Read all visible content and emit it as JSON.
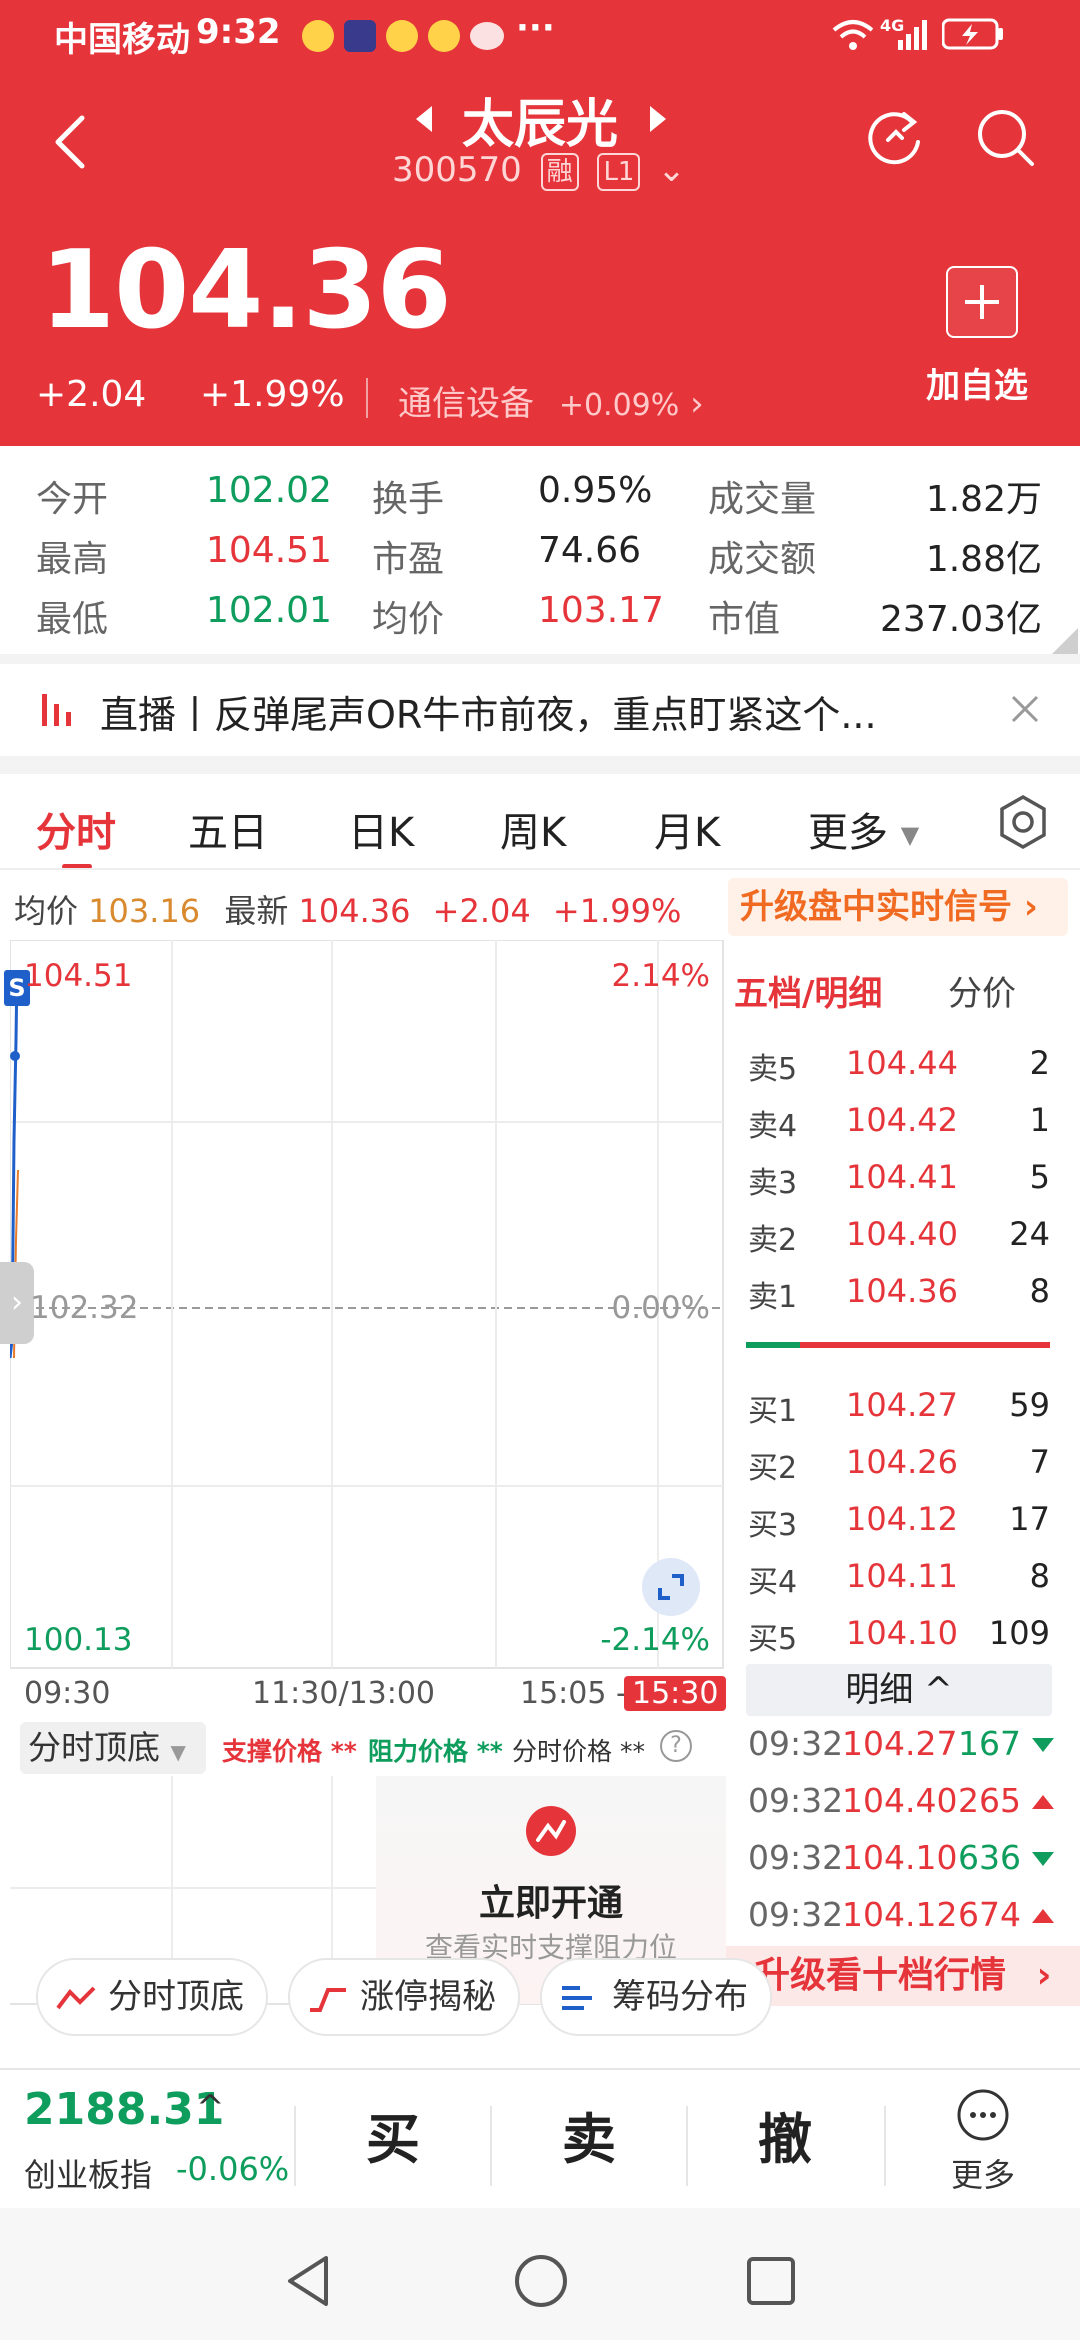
{
  "status_bar": {
    "carrier": "中国移动",
    "time": "9:32",
    "network": "4G",
    "more": "···"
  },
  "header": {
    "stock_name": "太辰光",
    "stock_code": "300570",
    "tag_margin": "融",
    "tag_level": "L1",
    "price": "104.36",
    "change": "+2.04",
    "change_pct": "+1.99%",
    "sector": "通信设备",
    "sector_change": "+0.09%",
    "add_label": "加自选",
    "accent_color": "#e5353b"
  },
  "stats": {
    "open_label": "今开",
    "open": "102.02",
    "high_label": "最高",
    "high": "104.51",
    "low_label": "最低",
    "low": "102.01",
    "turnover_label": "换手",
    "turnover": "0.95%",
    "pe_label": "市盈",
    "pe": "74.66",
    "avg_label": "均价",
    "avg": "103.17",
    "volume_label": "成交量",
    "volume": "1.82万",
    "amount_label": "成交额",
    "amount": "1.88亿",
    "mcap_label": "市值",
    "mcap": "237.03亿"
  },
  "news": {
    "text": "直播丨反弹尾声OR牛市前夜，重点盯紧这个..."
  },
  "tabs": [
    "分时",
    "五日",
    "日K",
    "周K",
    "月K",
    "更多"
  ],
  "info_line": {
    "avg_label": "均价",
    "avg": "103.16",
    "latest_label": "最新",
    "latest": "104.36",
    "change": "+2.04",
    "change_pct": "+1.99%",
    "upgrade": "升级盘中实时信号"
  },
  "chart": {
    "top_price": "104.51",
    "top_pct": "2.14%",
    "mid_price": "102.32",
    "mid_pct": "0.00%",
    "bottom_price": "100.13",
    "bottom_pct": "-2.14%",
    "time_start": "09:30",
    "time_mid": "11:30/13:00",
    "time_end": "15:05 -",
    "time_close": "15:30",
    "marker": "S"
  },
  "orderbook": {
    "tab_active": "五档/明细",
    "tab_other": "分价",
    "asks": [
      {
        "label": "卖5",
        "price": "104.44",
        "vol": "2"
      },
      {
        "label": "卖4",
        "price": "104.42",
        "vol": "1"
      },
      {
        "label": "卖3",
        "price": "104.41",
        "vol": "5"
      },
      {
        "label": "卖2",
        "price": "104.40",
        "vol": "24"
      },
      {
        "label": "卖1",
        "price": "104.36",
        "vol": "8"
      }
    ],
    "bids": [
      {
        "label": "买1",
        "price": "104.27",
        "vol": "59"
      },
      {
        "label": "买2",
        "price": "104.26",
        "vol": "7"
      },
      {
        "label": "买3",
        "price": "104.12",
        "vol": "17"
      },
      {
        "label": "买4",
        "price": "104.11",
        "vol": "8"
      },
      {
        "label": "买5",
        "price": "104.10",
        "vol": "109"
      }
    ],
    "detail_label": "明细",
    "ticks": [
      {
        "time": "09:32",
        "price": "104.27",
        "vol": "167",
        "dir": "down"
      },
      {
        "time": "09:32",
        "price": "104.40",
        "vol": "265",
        "dir": "up"
      },
      {
        "time": "09:32",
        "price": "104.10",
        "vol": "636",
        "dir": "down"
      },
      {
        "time": "09:32",
        "price": "104.12",
        "vol": "674",
        "dir": "up"
      }
    ],
    "upgrade": "升级看十档行情"
  },
  "indicator": {
    "dropdown": "分时顶底",
    "support": "支撑价格 **",
    "resistance": "阻力价格 **",
    "intraday": "分时价格 **",
    "open_title": "立即开通",
    "open_sub": "查看实时支撑阻力位"
  },
  "pills": [
    "分时顶底",
    "涨停揭秘",
    "筹码分布"
  ],
  "bottom": {
    "index_value": "2188.31",
    "index_name": "创业板指",
    "index_change": "-0.06%",
    "buy": "买",
    "sell": "卖",
    "cancel": "撤",
    "more": "更多"
  }
}
